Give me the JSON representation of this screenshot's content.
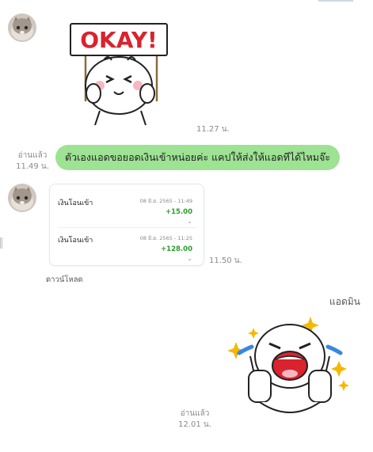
{
  "messages": {
    "sticker1": {
      "sign_text": "OKAY!",
      "time": "11.27 น."
    },
    "text1": {
      "read_label": "อ่านแล้ว",
      "read_time": "11.49 น.",
      "text": "ตัวเองแอดขอยอดเงินเข้าหน่อยค่ะ แคปให้ส่งให้แอดทีได้ไหมจ๊ะ"
    },
    "transfer_card": {
      "rows": [
        {
          "title": "เงินโอนเข้า",
          "date": "08 มิ.ย. 2565 - 11:49",
          "amount": "+15.00"
        },
        {
          "title": "เงินโอนเข้า",
          "date": "08 มิ.ย. 2565 - 11:25",
          "amount": "+128.00"
        }
      ],
      "time": "11.50 น.",
      "download_label": "ดาวน์โหลด"
    },
    "admin_name": "แอดมิน",
    "sticker2": {
      "read_label": "อ่านแล้ว",
      "read_time": "12.01 น."
    }
  },
  "icons": {
    "avatar": "cat-avatar-icon",
    "chevron": "chevron-down-icon",
    "sparkle": "sparkle-icon"
  },
  "colors": {
    "bubble": "#9ee294",
    "amount": "#2a9d2a",
    "sign_red": "#d9232e",
    "tears": "#3a86e0",
    "sparkle": "#f5b800"
  }
}
